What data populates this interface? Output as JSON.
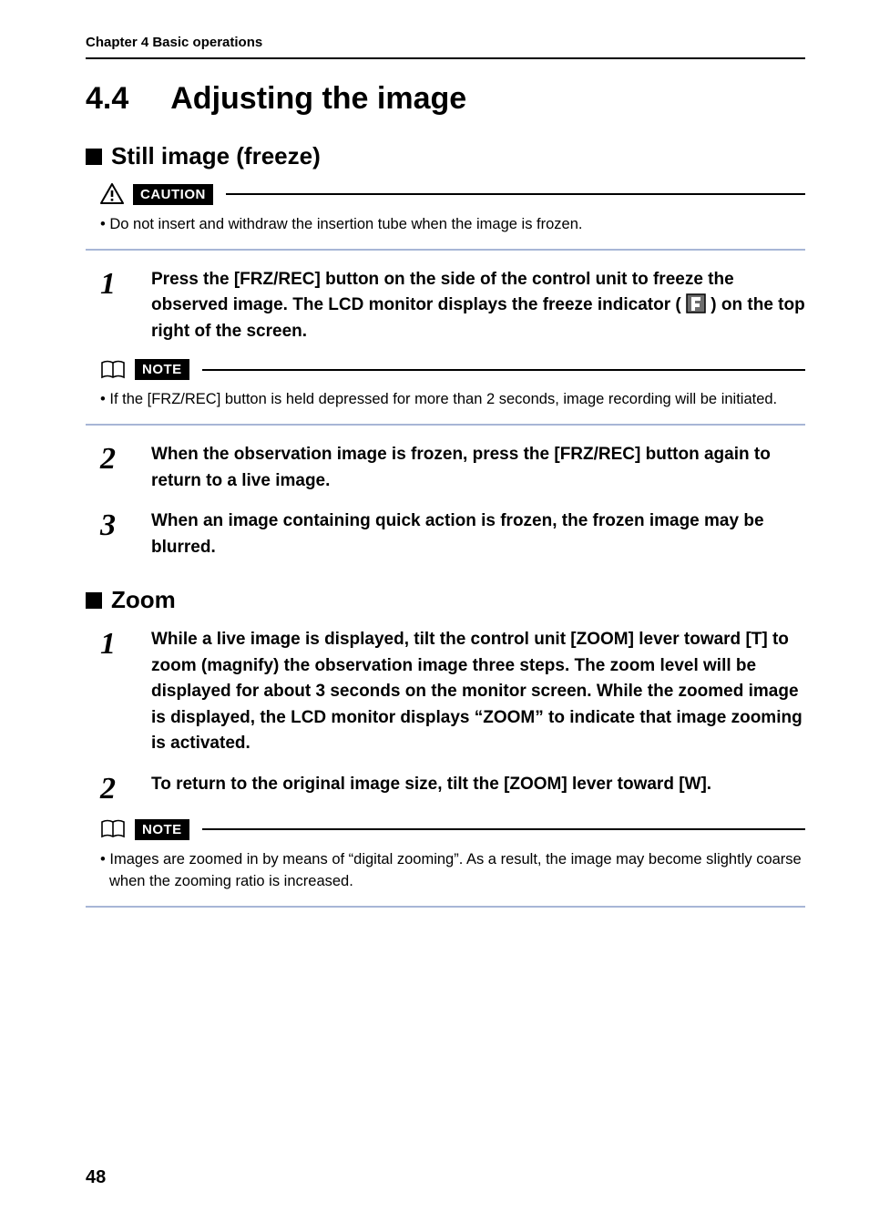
{
  "header": {
    "chapter": "Chapter 4 Basic operations"
  },
  "section": {
    "number": "4.4",
    "title": "Adjusting the image"
  },
  "subsections": {
    "still": {
      "title": "Still image (freeze)",
      "caution_label": "CAUTION",
      "caution_text": "• Do not insert and withdraw the insertion tube when the image is frozen.",
      "note_label": "NOTE",
      "note_text": "• If the [FRZ/REC] button is held depressed for more than 2 seconds, image recording will be initiated.",
      "steps": {
        "s1_pre": "Press the [FRZ/REC] button on the side of the control unit to freeze the observed image. The LCD monitor displays the freeze indicator ( ",
        "s1_post": " ) on the top right of the screen.",
        "s2": "When the observation image is frozen, press the [FRZ/REC] button again to return to a live image.",
        "s3": "When an image containing quick action is frozen, the frozen image may be blurred."
      }
    },
    "zoom": {
      "title": "Zoom",
      "note_label": "NOTE",
      "note_text": "• Images are zoomed in by means of “digital zooming”. As a result, the image may become slightly coarse when the zooming ratio is increased.",
      "steps": {
        "s1": "While a live image is displayed, tilt the control unit [ZOOM] lever toward [T] to zoom (magnify) the observation image three steps. The zoom level will be displayed for about 3 seconds on the monitor screen. While the zoomed image is displayed, the LCD monitor displays “ZOOM” to indicate that image zooming is activated.",
        "s2": "To return to the original image size, tilt the [ZOOM] lever toward [W]."
      }
    }
  },
  "step_numbers": {
    "one": "1",
    "two": "2",
    "three": "3"
  },
  "page_number": "48"
}
